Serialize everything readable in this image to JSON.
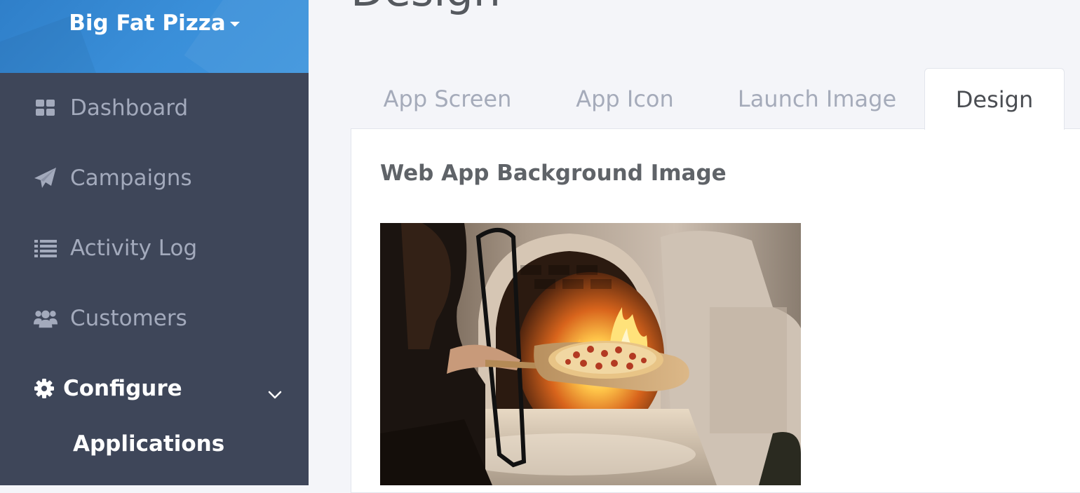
{
  "sidebar": {
    "brand": {
      "title": "Big Fat Pizza"
    },
    "items": [
      {
        "label": "Dashboard",
        "icon": "dashboard-grid-icon"
      },
      {
        "label": "Campaigns",
        "icon": "paper-plane-icon"
      },
      {
        "label": "Activity Log",
        "icon": "list-icon"
      },
      {
        "label": "Customers",
        "icon": "users-icon"
      },
      {
        "label": "Configure",
        "icon": "gear-icon",
        "active": true,
        "expanded": true
      }
    ],
    "sub_items": [
      {
        "label": "Applications",
        "active": true
      }
    ]
  },
  "main": {
    "page_title": "Design",
    "tabs": [
      {
        "label": "App Screen"
      },
      {
        "label": "App Icon"
      },
      {
        "label": "Launch Image"
      },
      {
        "label": "Design",
        "active": true
      }
    ],
    "panel": {
      "heading": "Web App Background Image",
      "image_subject": "pizza-oven-photo"
    }
  },
  "colors": {
    "sidebar_bg": "#3e4659",
    "brand_bg": "#3a8fd9",
    "nav_text": "#a3aabc",
    "nav_active_text": "#ffffff",
    "page_bg": "#f4f5f9",
    "tab_inactive_text": "#a5abba",
    "tab_active_text": "#4a4d52"
  }
}
